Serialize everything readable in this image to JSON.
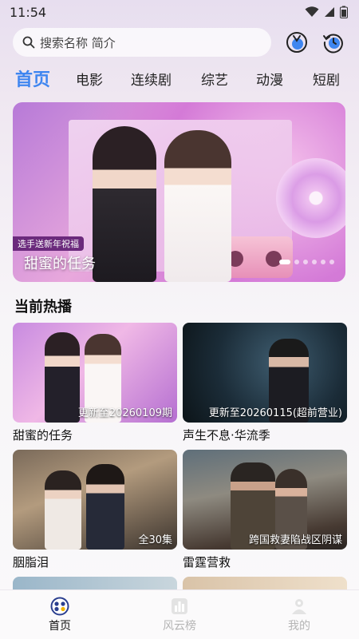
{
  "status_bar": {
    "time": "11:54"
  },
  "search": {
    "placeholder": "搜索名称 简介"
  },
  "tabs": [
    {
      "label": "首页",
      "active": true
    },
    {
      "label": "电影"
    },
    {
      "label": "连续剧"
    },
    {
      "label": "综艺"
    },
    {
      "label": "动漫"
    },
    {
      "label": "短剧"
    }
  ],
  "banner": {
    "title": "甜蜜的任务",
    "tag": "选手送新年祝福",
    "slide_count": 6,
    "active_slide": 1
  },
  "section": {
    "title": "当前热播"
  },
  "cards": [
    {
      "title": "甜蜜的任务",
      "badge": "更新至20260109期"
    },
    {
      "title": "声生不息·华流季",
      "badge": "更新至20260115(超前营业)"
    },
    {
      "title": "胭脂泪",
      "badge": "全30集"
    },
    {
      "title": "雷霆营救",
      "badge": "跨国救妻陷战区阴谋"
    }
  ],
  "bottom_nav": [
    {
      "label": "首页",
      "icon": "home-icon",
      "active": true
    },
    {
      "label": "风云榜",
      "icon": "chart-icon"
    },
    {
      "label": "我的",
      "icon": "profile-icon"
    }
  ],
  "colors": {
    "accent": "#3f86f0"
  }
}
